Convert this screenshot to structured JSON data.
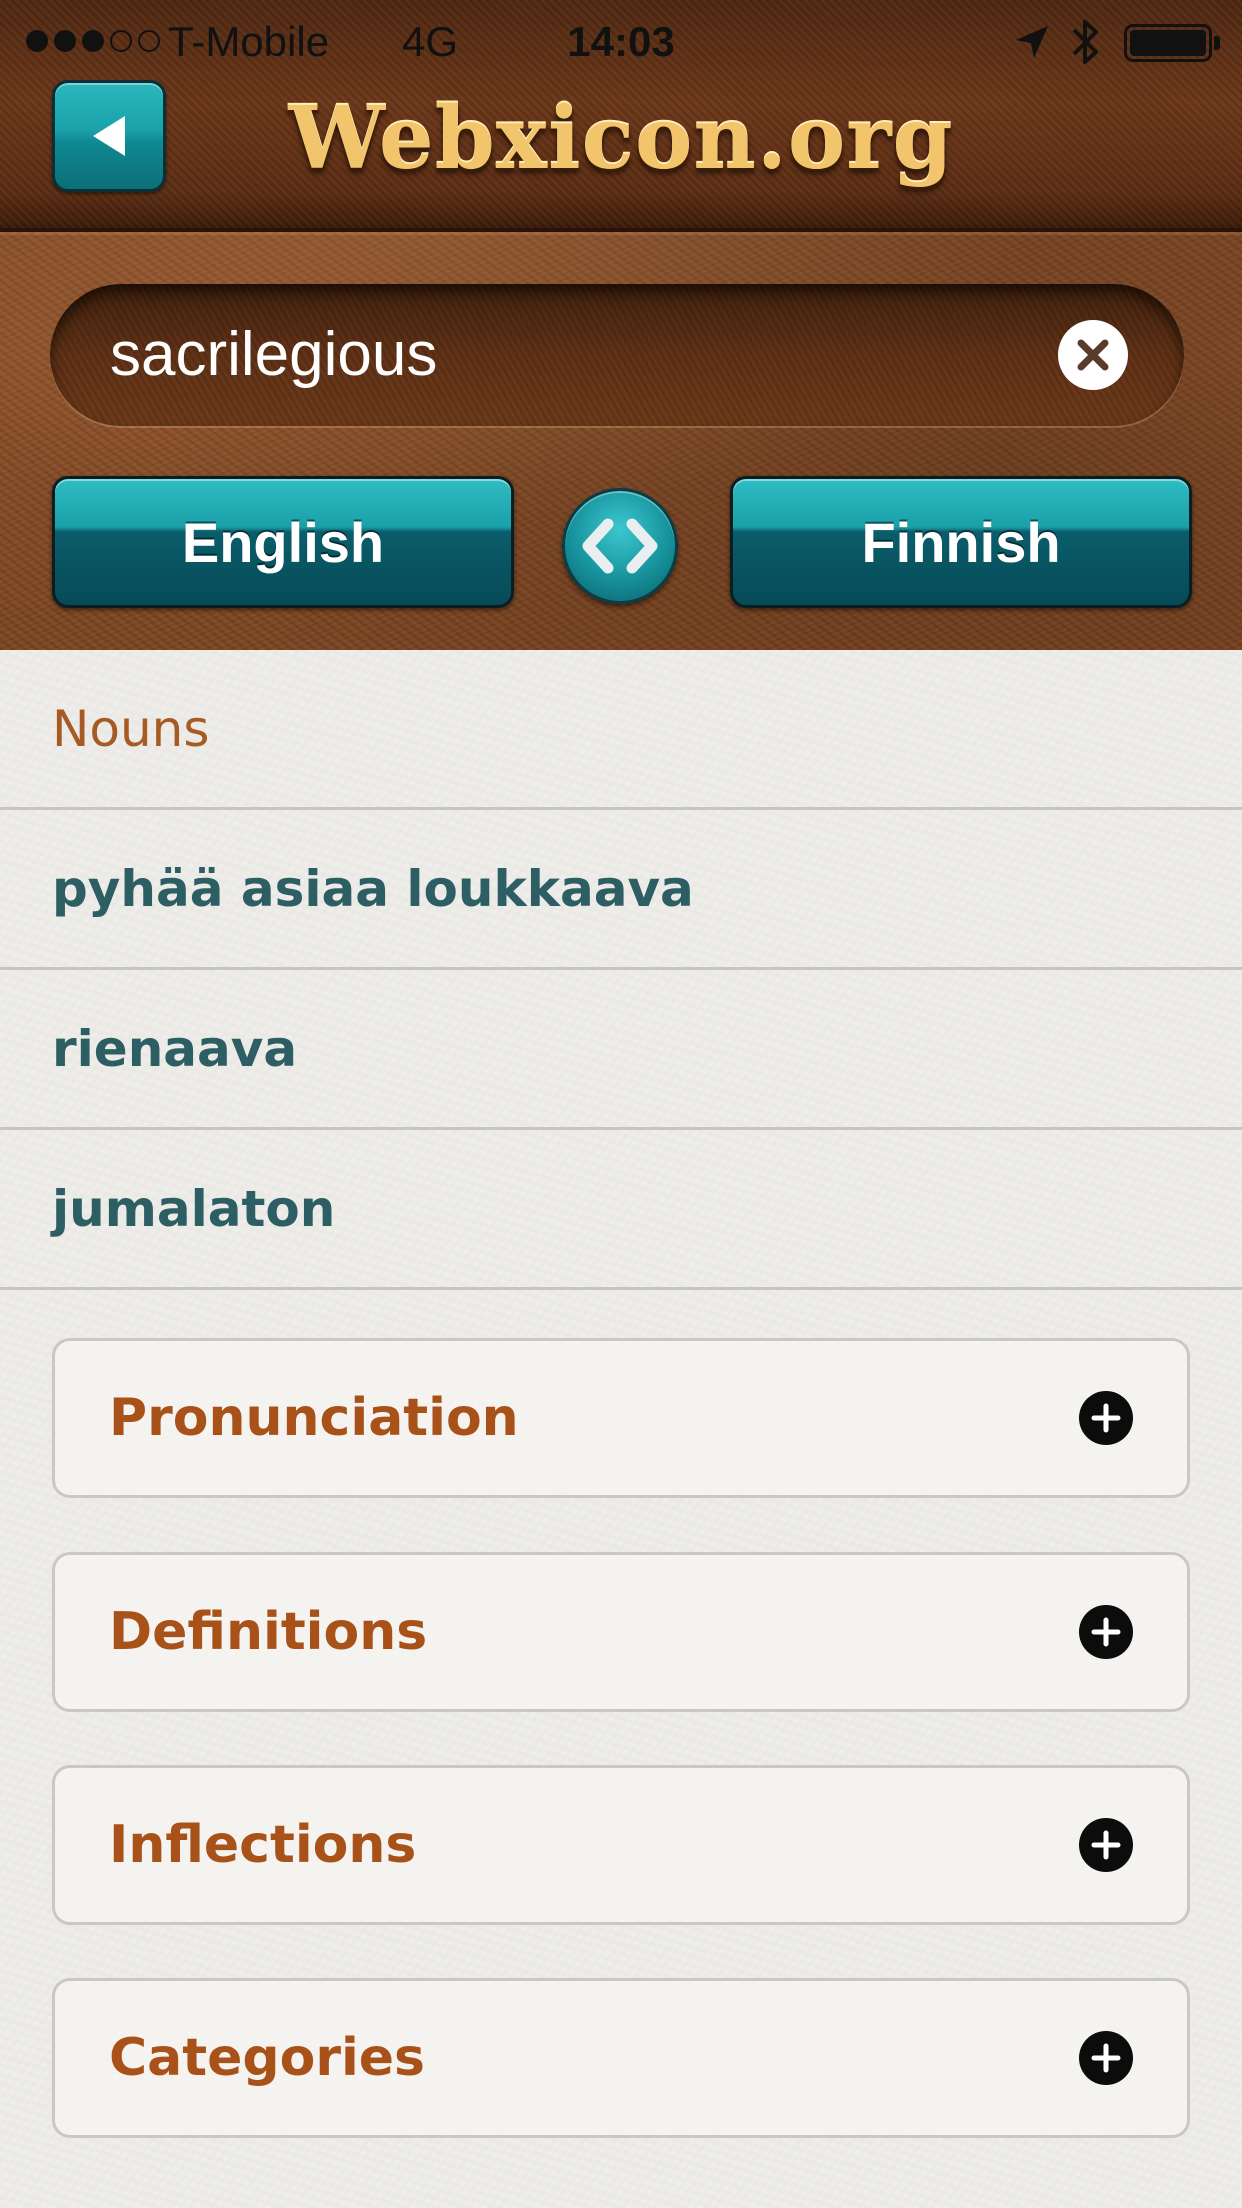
{
  "status_bar": {
    "carrier": "T-Mobile",
    "network": "4G",
    "time": "14:03",
    "signal_bars_filled": 3,
    "signal_bars_total": 5,
    "icons": [
      "location-arrow-icon",
      "bluetooth-icon",
      "battery-icon"
    ],
    "battery_level": 1.0
  },
  "header": {
    "logo": "Webxicon.org",
    "back_icon": "back-arrow-icon"
  },
  "search": {
    "value": "sacrilegious",
    "clear_icon": "clear-x-icon"
  },
  "languages": {
    "from": "English",
    "to": "Finnish",
    "swap_icon": "swap-arrows-icon"
  },
  "results": {
    "section_title": "Nouns",
    "items": [
      {
        "label": "pyhää asiaa loukkaava"
      },
      {
        "label": "rienaava"
      },
      {
        "label": "jumalaton"
      }
    ]
  },
  "panels": [
    {
      "label": "Pronunciation",
      "icon": "plus-circle-icon"
    },
    {
      "label": "Definitions",
      "icon": "plus-circle-icon"
    },
    {
      "label": "Inflections",
      "icon": "plus-circle-icon"
    },
    {
      "label": "Categories",
      "icon": "plus-circle-icon"
    }
  ],
  "colors": {
    "leather": "#7c4421",
    "teal": "#1ba0a9",
    "section_heading": "#a65a24",
    "result_text": "#2d5e63",
    "panel_label": "#a85219"
  }
}
